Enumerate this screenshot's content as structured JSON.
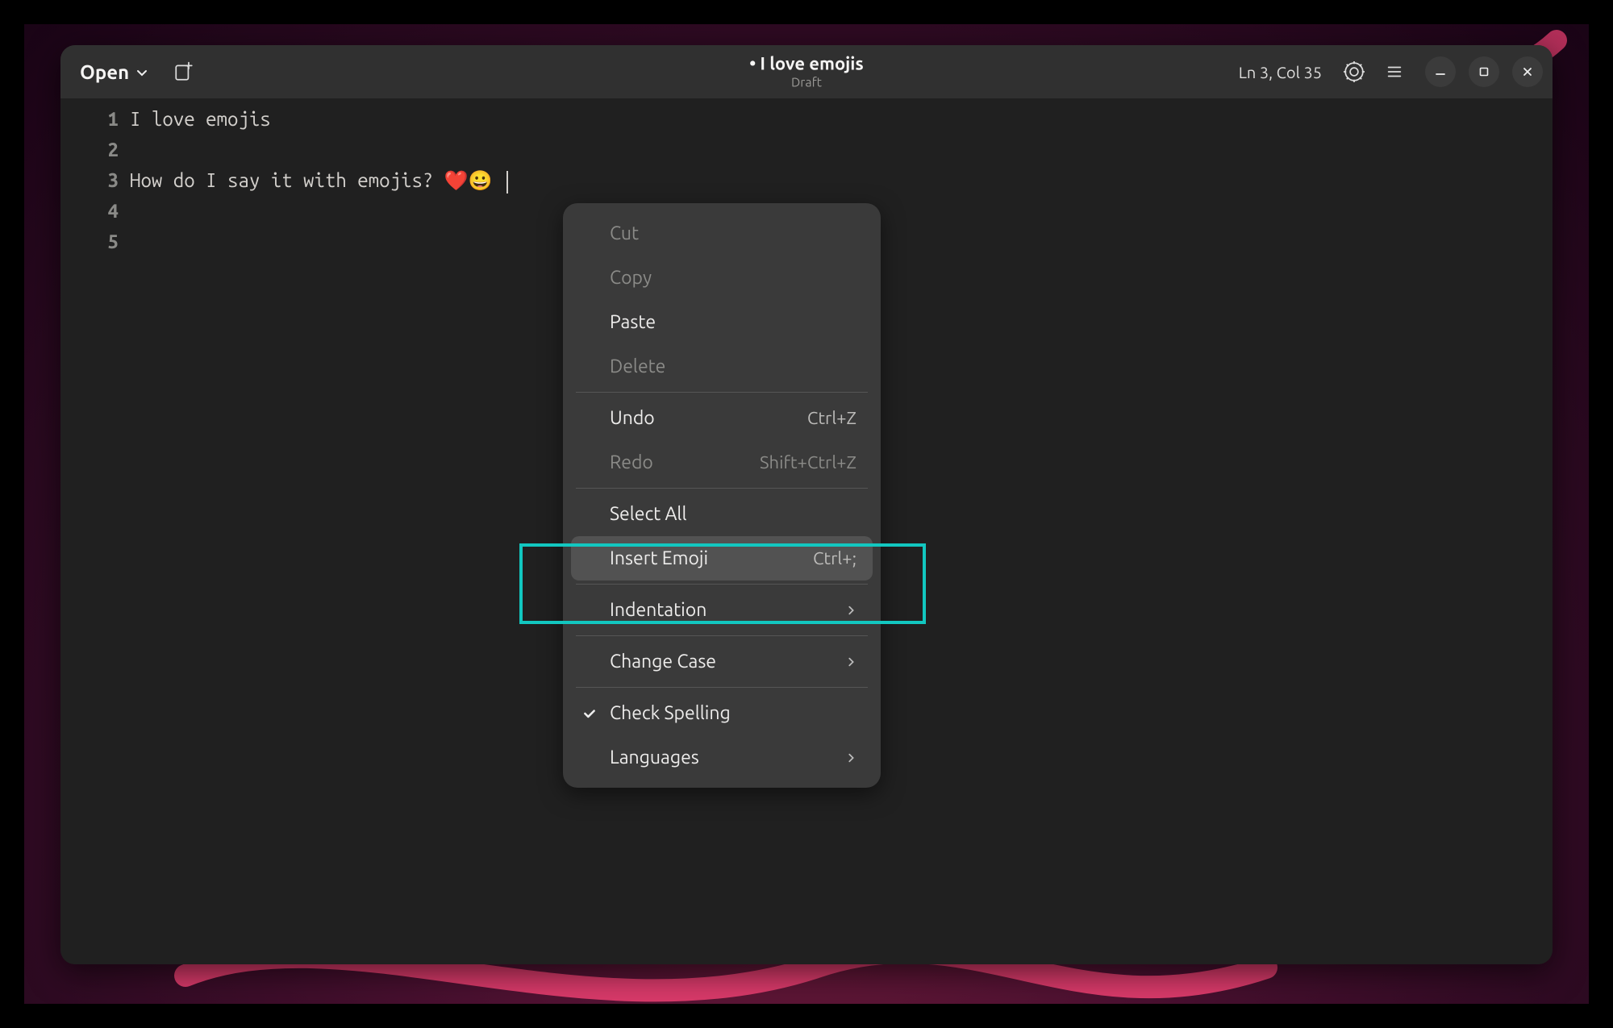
{
  "header": {
    "open_label": "Open",
    "title": "• I love emojis",
    "subtitle": "Draft",
    "position": "Ln 3, Col 35"
  },
  "editor": {
    "lines": [
      "I love emojis",
      "",
      "How do I say it with emojis? ❤️😀 ",
      "",
      ""
    ],
    "cursor_line": 3
  },
  "context_menu": {
    "cut": "Cut",
    "copy": "Copy",
    "paste": "Paste",
    "delete": "Delete",
    "undo": {
      "label": "Undo",
      "accel": "Ctrl+Z"
    },
    "redo": {
      "label": "Redo",
      "accel": "Shift+Ctrl+Z"
    },
    "select_all": "Select All",
    "insert_emoji": {
      "label": "Insert Emoji",
      "accel": "Ctrl+;"
    },
    "indentation": "Indentation",
    "change_case": "Change Case",
    "check_spelling": "Check Spelling",
    "languages": "Languages"
  }
}
